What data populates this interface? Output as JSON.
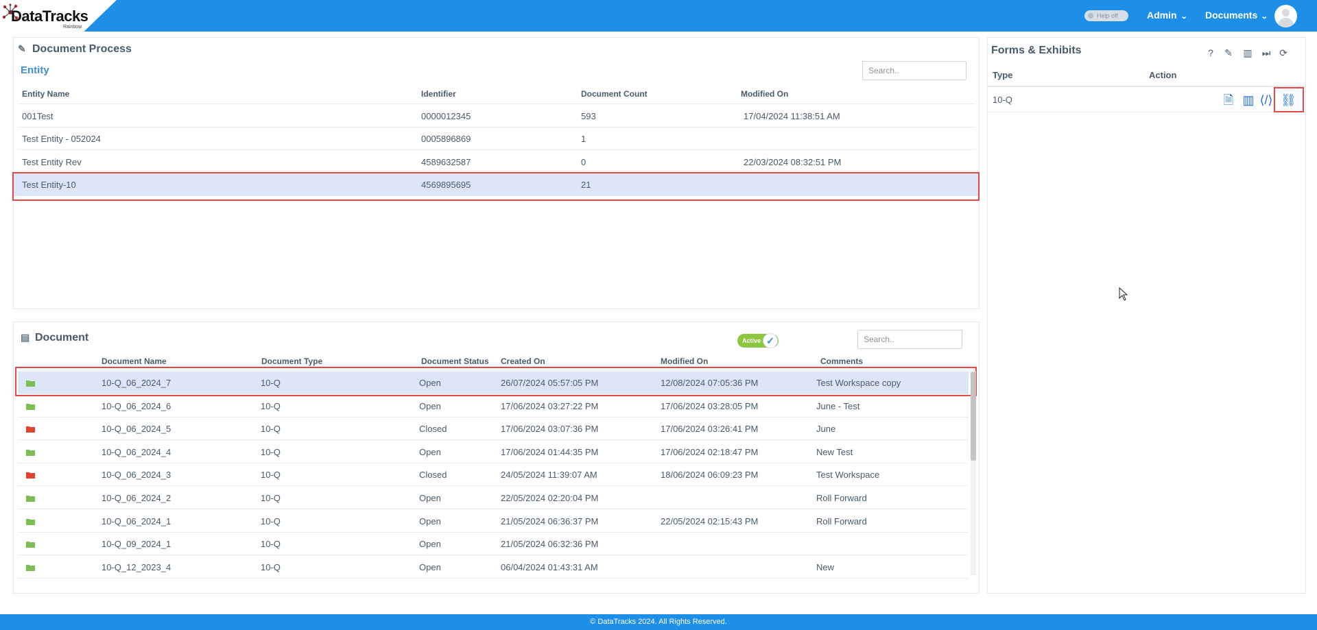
{
  "app": {
    "brand": "DataTracks",
    "brand_sub": "Rainbow",
    "help_toggle": "Help off",
    "menu_admin": "Admin",
    "menu_documents": "Documents",
    "footer": "© DataTracks 2024. All Rights Reserved."
  },
  "document_process": {
    "title": "Document Process",
    "entity_title": "Entity",
    "search_placeholder": "Search..",
    "columns": [
      "Entity Name",
      "Identifier",
      "Document Count",
      "Modified On"
    ],
    "rows": [
      {
        "name": "001Test",
        "identifier": "0000012345",
        "count": "593",
        "modified": "17/04/2024 11:38:51 AM"
      },
      {
        "name": "Test Entity - 052024",
        "identifier": "0005896869",
        "count": "1",
        "modified": ""
      },
      {
        "name": "Test Entity Rev",
        "identifier": "4589632587",
        "count": "0",
        "modified": "22/03/2024 08:32:51 PM"
      },
      {
        "name": "Test Entity-10",
        "identifier": "4569895695",
        "count": "21",
        "modified": ""
      }
    ],
    "selected_row": 3
  },
  "document": {
    "title": "Document",
    "active_label": "Active",
    "search_placeholder": "Search..",
    "columns": [
      "Document Name",
      "Document Type",
      "Document Status",
      "Created On",
      "Modified On",
      "Comments"
    ],
    "rows": [
      {
        "name": "10-Q_06_2024_7",
        "type": "10-Q",
        "status": "Open",
        "created": "26/07/2024 05:57:05 PM",
        "modified": "12/08/2024 07:05:36 PM",
        "comments": "Test Workspace copy"
      },
      {
        "name": "10-Q_06_2024_6",
        "type": "10-Q",
        "status": "Open",
        "created": "17/06/2024 03:27:22 PM",
        "modified": "17/06/2024 03:28:05 PM",
        "comments": "June - Test"
      },
      {
        "name": "10-Q_06_2024_5",
        "type": "10-Q",
        "status": "Closed",
        "created": "17/06/2024 03:07:36 PM",
        "modified": "17/06/2024 03:26:41 PM",
        "comments": "June"
      },
      {
        "name": "10-Q_06_2024_4",
        "type": "10-Q",
        "status": "Open",
        "created": "17/06/2024 01:44:35 PM",
        "modified": "17/06/2024 02:18:47 PM",
        "comments": "New Test"
      },
      {
        "name": "10-Q_06_2024_3",
        "type": "10-Q",
        "status": "Closed",
        "created": "24/05/2024 11:39:07 AM",
        "modified": "18/06/2024 06:09:23 PM",
        "comments": "Test Workspace"
      },
      {
        "name": "10-Q_06_2024_2",
        "type": "10-Q",
        "status": "Open",
        "created": "22/05/2024 02:20:04 PM",
        "modified": "",
        "comments": "Roll Forward"
      },
      {
        "name": "10-Q_06_2024_1",
        "type": "10-Q",
        "status": "Open",
        "created": "21/05/2024 06:36:37 PM",
        "modified": "22/05/2024 02:15:43 PM",
        "comments": "Roll Forward"
      },
      {
        "name": "10-Q_09_2024_1",
        "type": "10-Q",
        "status": "Open",
        "created": "21/05/2024 06:32:36 PM",
        "modified": "",
        "comments": ""
      },
      {
        "name": "10-Q_12_2023_4",
        "type": "10-Q",
        "status": "Open",
        "created": "06/04/2024 01:43:31 AM",
        "modified": "",
        "comments": "New"
      }
    ],
    "selected_row": 0
  },
  "forms_exhibits": {
    "title": "Forms & Exhibits",
    "columns": [
      "Type",
      "Action"
    ],
    "rows": [
      {
        "type": "10-Q"
      }
    ],
    "tool_icons": [
      "question-icon",
      "edit-icon",
      "book-icon",
      "fast-forward-icon",
      "refresh-icon"
    ],
    "action_icons": [
      "document-icon",
      "book-icon",
      "code-file-icon",
      "link-icon"
    ]
  },
  "colors": {
    "header_blue": "#1e8fe9",
    "selection": "#dde6f9",
    "highlight": "#e84848",
    "open_folder": "#7bbf54",
    "closed_folder": "#e0442f",
    "active_toggle": "#8dc63f"
  }
}
